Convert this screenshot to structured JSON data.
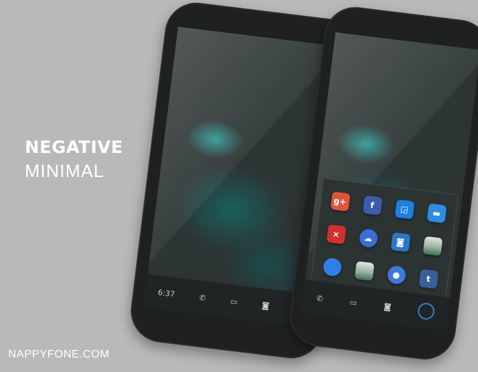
{
  "headline": {
    "line1": "NEGATIVE",
    "line2": "MINIMAL"
  },
  "brand": "NAPPYFONE.COM",
  "left_phone": {
    "dock": [
      {
        "name": "clock",
        "label": "6:37"
      },
      {
        "name": "phone-icon",
        "label": "✆"
      },
      {
        "name": "messages-icon",
        "label": "▭"
      },
      {
        "name": "camera-icon",
        "label": "◙"
      },
      {
        "name": "add-icon",
        "label": "+"
      }
    ]
  },
  "right_phone": {
    "folder_apps": [
      {
        "name": "google-plus-icon",
        "glyph": "g+",
        "color": "#e0543f"
      },
      {
        "name": "facebook-icon",
        "glyph": "f",
        "color": "#3c5ba8"
      },
      {
        "name": "foursquare-icon",
        "glyph": "◲",
        "color": "#1e7fe0"
      },
      {
        "name": "folder-icon",
        "glyph": "▬",
        "color": "#2f8ce0"
      },
      {
        "name": "close-app-icon",
        "glyph": "×",
        "color": "#d3312e"
      },
      {
        "name": "weather-icon",
        "glyph": "☁",
        "color": "#3b6fd6"
      },
      {
        "name": "instagram-icon",
        "glyph": "◙",
        "color": "#2b78c9"
      },
      {
        "name": "gallery-icon",
        "glyph": "",
        "color": "#7ea9d0"
      },
      {
        "name": "blue-circle-app-icon",
        "glyph": "",
        "color": "#2f7fe6"
      },
      {
        "name": "photo-app-icon",
        "glyph": "",
        "color": "#8aa88f"
      },
      {
        "name": "white-dot-app-icon",
        "glyph": "●",
        "color": "#3d79d6"
      },
      {
        "name": "tumblr-icon",
        "glyph": "t",
        "color": "#3a5e9a"
      }
    ],
    "dock": [
      {
        "name": "phone-icon",
        "label": "✆"
      },
      {
        "name": "messages-icon",
        "label": "▭"
      },
      {
        "name": "camera-icon",
        "label": "◙"
      }
    ]
  }
}
